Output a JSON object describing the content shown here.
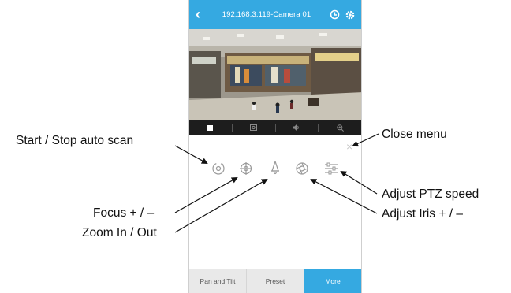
{
  "header": {
    "title": "192.168.3.119-Camera 01",
    "back_icon": "back-arrow-icon",
    "refresh_icon": "refresh-icon",
    "settings_icon": "gear-icon"
  },
  "video_toolbar": {
    "icons": [
      "stop-icon",
      "snapshot-icon",
      "audio-icon",
      "zoom-icon"
    ]
  },
  "ptz_controls": {
    "icons": [
      "auto-scan-icon",
      "focus-icon",
      "zoom-in-out-icon",
      "iris-icon",
      "ptz-speed-icon"
    ],
    "close_icon": "close-icon"
  },
  "tabs": [
    {
      "label": "Pan and Tilt"
    },
    {
      "label": "Preset"
    },
    {
      "label": "More",
      "active": true
    }
  ],
  "callouts": {
    "auto_scan": "Start / Stop auto scan",
    "close_menu": "Close menu",
    "ptz_speed": "Adjust PTZ speed",
    "iris": "Adjust Iris + / –",
    "focus": "Focus + / –",
    "zoom": "Zoom In / Out"
  },
  "colors": {
    "accent": "#35a9e1",
    "toolbar": "#1d1d1d",
    "icon_gray": "#9a9a9a"
  }
}
